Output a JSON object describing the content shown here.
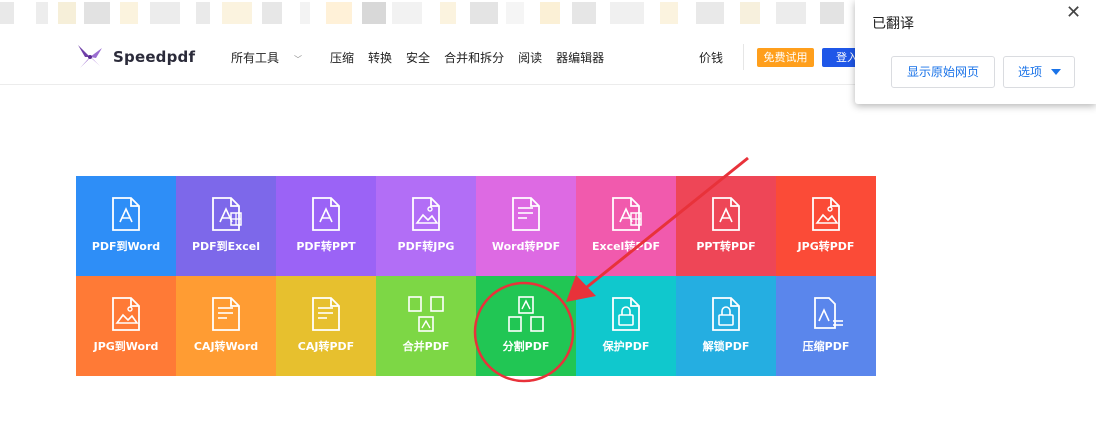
{
  "header": {
    "brand": "Speedpdf",
    "nav": [
      "所有工具",
      "压缩",
      "转换",
      "安全",
      "合并和拆分",
      "阅读",
      "器编辑器"
    ],
    "price": "价钱",
    "trial_button": "免费试用",
    "login_button": "登入"
  },
  "tools": [
    {
      "label": "PDF到Word",
      "color": "#2e8ef7",
      "icon": "pdf-doc-icon"
    },
    {
      "label": "PDF到Excel",
      "color": "#7d68ea",
      "icon": "pdf-excel-icon"
    },
    {
      "label": "PDF转PPT",
      "color": "#9b63f6",
      "icon": "pdf-ppt-icon"
    },
    {
      "label": "PDF转JPG",
      "color": "#b26ef6",
      "icon": "pdf-image-icon"
    },
    {
      "label": "Word转PDF",
      "color": "#dd6ae3",
      "icon": "word-doc-icon"
    },
    {
      "label": "Excel转PDF",
      "color": "#f15aad",
      "icon": "excel-doc-icon"
    },
    {
      "label": "PPT转PDF",
      "color": "#ee4657",
      "icon": "ppt-doc-icon"
    },
    {
      "label": "JPG转PDF",
      "color": "#fb4b37",
      "icon": "image-doc-icon"
    },
    {
      "label": "JPG到Word",
      "color": "#ff7a36",
      "icon": "image-word-icon"
    },
    {
      "label": "CAJ转Word",
      "color": "#ff9c33",
      "icon": "caj-word-icon"
    },
    {
      "label": "CAJ转PDF",
      "color": "#e7c02e",
      "icon": "caj-pdf-icon"
    },
    {
      "label": "合并PDF",
      "color": "#7dd745",
      "icon": "merge-pdf-icon"
    },
    {
      "label": "分割PDF",
      "color": "#21c654",
      "icon": "split-pdf-icon"
    },
    {
      "label": "保护PDF",
      "color": "#10c8cd",
      "icon": "lock-doc-icon"
    },
    {
      "label": "解锁PDF",
      "color": "#25aee1",
      "icon": "unlock-doc-icon"
    },
    {
      "label": "压缩PDF",
      "color": "#5a86ec",
      "icon": "compress-pdf-icon"
    }
  ],
  "translate_popup": {
    "title": "已翻译",
    "show_original": "显示原始网页",
    "options": "选项",
    "close": "✕"
  },
  "annotation": {
    "color": "#e8323a"
  }
}
